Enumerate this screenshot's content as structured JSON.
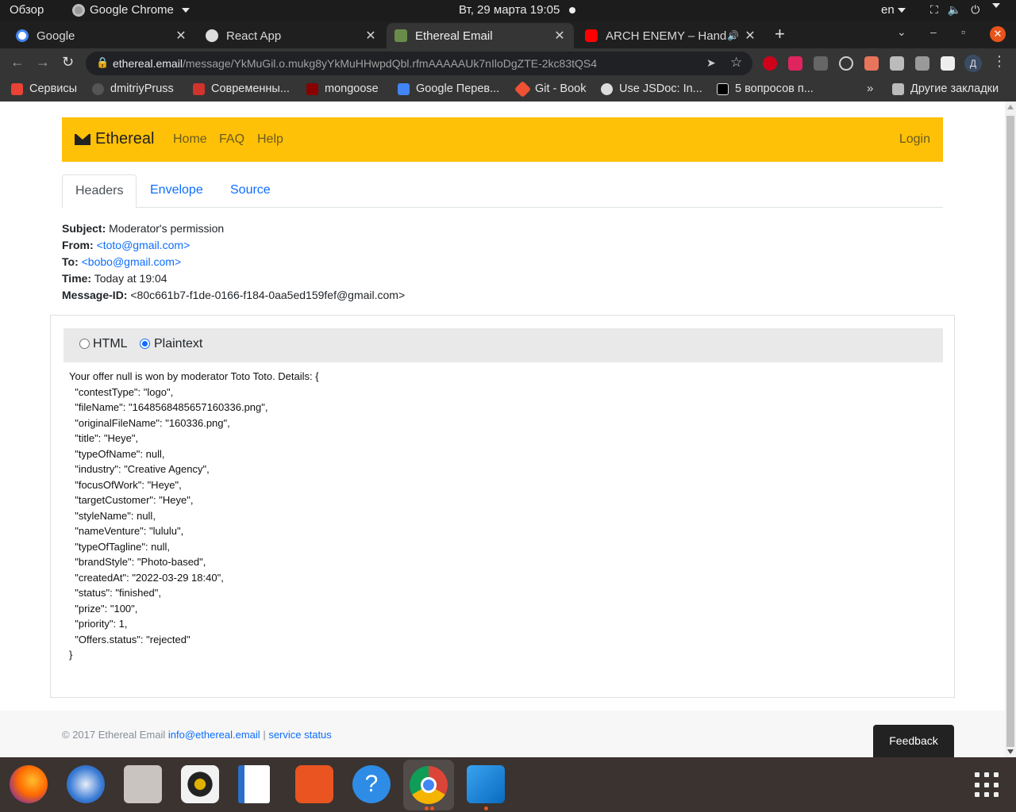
{
  "system_bar": {
    "activities": "Обзор",
    "app_name": "Google Chrome",
    "clock": "Вт, 29 марта  19:05",
    "language": "en"
  },
  "browser": {
    "tabs": [
      {
        "title": "Google",
        "active": false
      },
      {
        "title": "React App",
        "active": false
      },
      {
        "title": "Ethereal Email",
        "active": true
      },
      {
        "title": "ARCH ENEMY – Handsh",
        "active": false
      }
    ],
    "url_host": "ethereal.email",
    "url_path": "/message/YkMuGil.o.mukg8yYkMuHHwpdQbl.rfmAAAAAUk7nIloDgZTE-2kc83tQS4",
    "profile_initial": "Д",
    "bookmarks": [
      {
        "label": "Сервисы",
        "color": "#ea4335"
      },
      {
        "label": "dmitriyPruss",
        "color": "#555555"
      },
      {
        "label": "Современны...",
        "color": "#d0342c"
      },
      {
        "label": "mongoose",
        "color": "#880000"
      },
      {
        "label": "Google Перев...",
        "color": "#4285f4"
      },
      {
        "label": "Git - Book",
        "color": "#f05133"
      },
      {
        "label": "Use JSDoc: In...",
        "color": "#dddddd"
      },
      {
        "label": "5 вопросов п...",
        "color": "#000000"
      }
    ],
    "other_bookmarks": "Другие закладки"
  },
  "site": {
    "brand": "Ethereal",
    "nav": [
      "Home",
      "FAQ",
      "Help"
    ],
    "login": "Login",
    "tabs": [
      "Headers",
      "Envelope",
      "Source"
    ],
    "headers": {
      "subject_label": "Subject:",
      "subject": "Moderator's permission",
      "from_label": "From:",
      "from": "<toto@gmail.com>",
      "to_label": "To:",
      "to": "<bobo@gmail.com>",
      "time_label": "Time:",
      "time": "Today at 19:04",
      "message_id_label": "Message-ID:",
      "message_id": "<80c661b7-f1de-0166-f184-0aa5ed159fef@gmail.com>"
    },
    "view_options": [
      "HTML",
      "Plaintext"
    ],
    "selected_view": "Plaintext",
    "plaintext_lines": [
      "Your offer null is won by moderator Toto Toto. Details: {",
      "  \"contestType\": \"logo\",",
      "  \"fileName\": \"1648568485657160336.png\",",
      "  \"originalFileName\": \"160336.png\",",
      "  \"title\": \"Heye\",",
      "  \"typeOfName\": null,",
      "  \"industry\": \"Creative Agency\",",
      "  \"focusOfWork\": \"Heye\",",
      "  \"targetCustomer\": \"Heye\",",
      "  \"styleName\": null,",
      "  \"nameVenture\": \"lululu\",",
      "  \"typeOfTagline\": null,",
      "  \"brandStyle\": \"Photo-based\",",
      "  \"createdAt\": \"2022-03-29 18:40\",",
      "  \"status\": \"finished\",",
      "  \"prize\": \"100\",",
      "  \"priority\": 1,",
      "  \"Offers.status\": \"rejected\"",
      "}"
    ],
    "footer": {
      "copyright": "© 2017 Ethereal Email ",
      "email": "info@ethereal.email",
      "separator": " | ",
      "status_link": "service status"
    },
    "feedback": "Feedback"
  },
  "dock": {
    "apps": [
      "firefox-icon",
      "thunderbird-icon",
      "files-icon",
      "rhythmbox-icon",
      "writer-icon",
      "software-icon",
      "help-icon",
      "chrome-icon",
      "vscode-icon"
    ]
  },
  "colors": {
    "brand_yellow": "#ffc107",
    "link_blue": "#0d6efd",
    "chrome_dark": "#353535"
  }
}
